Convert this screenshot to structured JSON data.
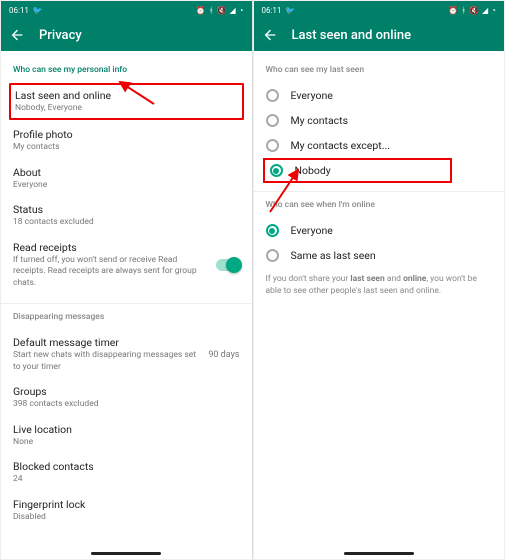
{
  "status": {
    "time": "06:11",
    "icons": [
      "alarm",
      "bt",
      "vol",
      "sig",
      "batt"
    ]
  },
  "left": {
    "header_title": "Privacy",
    "section_personal": "Who can see my personal info",
    "last_seen": {
      "title": "Last seen and online",
      "sub": "Nobody, Everyone"
    },
    "profile_photo": {
      "title": "Profile photo",
      "sub": "My contacts"
    },
    "about": {
      "title": "About",
      "sub": "Everyone"
    },
    "status": {
      "title": "Status",
      "sub": "18 contacts excluded"
    },
    "read_receipts": {
      "title": "Read receipts",
      "sub": "If turned off, you won't send or receive Read receipts. Read receipts are always sent for group chats."
    },
    "section_disappearing": "Disappearing messages",
    "default_timer": {
      "title": "Default message timer",
      "sub": "Start new chats with disappearing messages set to your timer",
      "value": "90 days"
    },
    "groups": {
      "title": "Groups",
      "sub": "398 contacts excluded"
    },
    "live_location": {
      "title": "Live location",
      "sub": "None"
    },
    "blocked": {
      "title": "Blocked contacts",
      "sub": "24"
    },
    "fingerprint": {
      "title": "Fingerprint lock",
      "sub": "Disabled"
    }
  },
  "right": {
    "header_title": "Last seen and online",
    "section_lastseen": "Who can see my last seen",
    "opt_everyone": "Everyone",
    "opt_contacts": "My contacts",
    "opt_except": "My contacts except...",
    "opt_nobody": "Nobody",
    "section_online": "Who can see when I'm online",
    "opt_online_everyone": "Everyone",
    "opt_online_same": "Same as last seen",
    "note_pre": "If you don't share your ",
    "note_b1": "last seen",
    "note_mid": " and ",
    "note_b2": "online",
    "note_post": ", you won't be able to see other people's last seen and online."
  }
}
